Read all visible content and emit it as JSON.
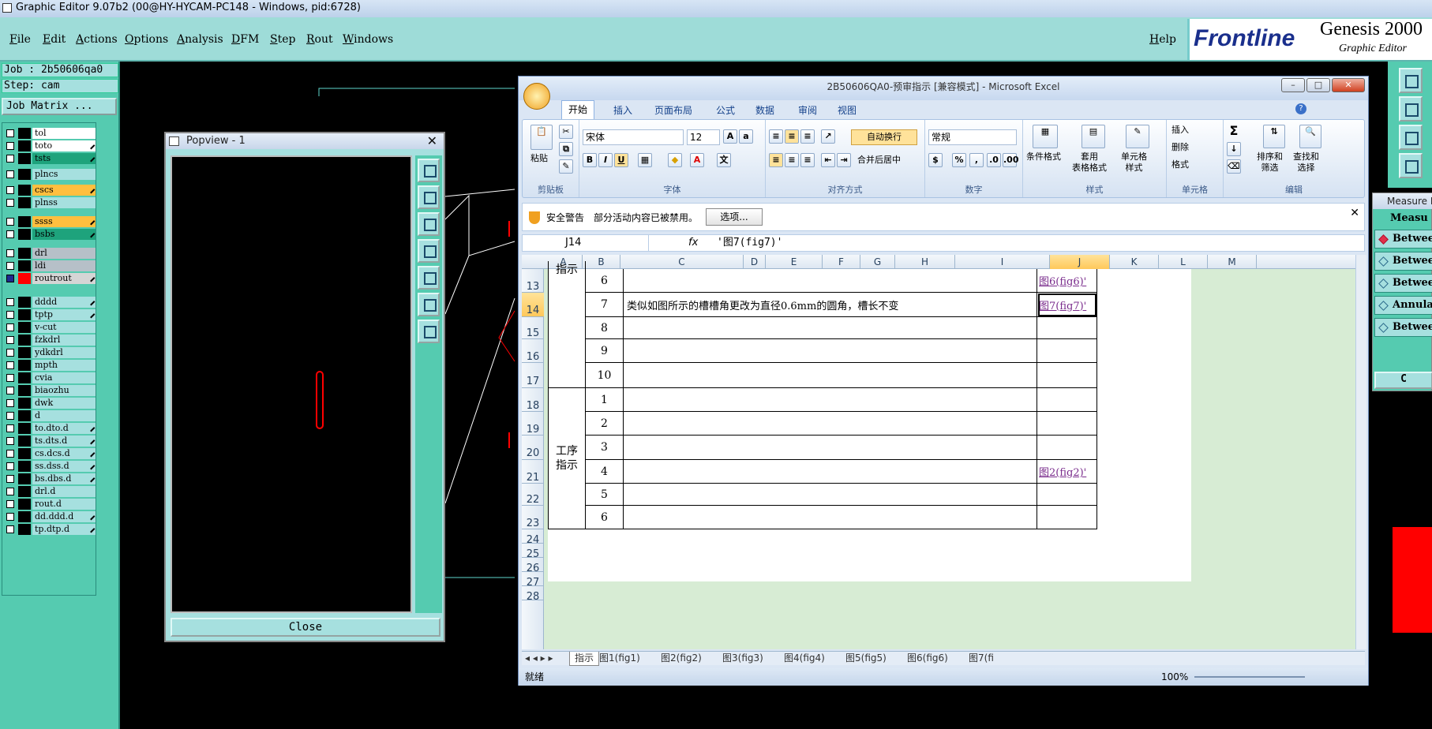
{
  "genesis": {
    "title": "Graphic Editor 9.07b2 (00@HY-HYCAM-PC148 - Windows, pid:6728)",
    "menu": [
      "File",
      "Edit",
      "Actions",
      "Options",
      "Analysis",
      "DFM",
      "Step",
      "Rout",
      "Windows"
    ],
    "help": "Help",
    "logo": {
      "brand": "Frontline",
      "product": "Genesis 2000",
      "subtitle": "Graphic Editor"
    }
  },
  "left_panel": {
    "job": "Job : 2b50606qa0",
    "step": "Step: cam",
    "job_matrix": "Job Matrix ...",
    "layers": [
      {
        "name": "tol",
        "color": "white",
        "checked": false,
        "pen": false
      },
      {
        "name": "to",
        "color": "white",
        "checked": false,
        "pen": true
      },
      {
        "name": "ts",
        "color": "green",
        "checked": false,
        "pen": true
      },
      {
        "name": "plncs",
        "color": "cyan",
        "checked": false,
        "pen": false
      },
      {
        "name": "cs",
        "color": "orange",
        "checked": false,
        "pen": true
      },
      {
        "name": "plnss",
        "color": "cyan",
        "checked": false,
        "pen": false
      },
      {
        "name": "ss",
        "color": "orange",
        "checked": false,
        "pen": true
      },
      {
        "name": "bs",
        "color": "green",
        "checked": false,
        "pen": true
      },
      {
        "name": "drl",
        "color": "gray",
        "checked": false,
        "pen": false
      },
      {
        "name": "ldi",
        "color": "gray",
        "checked": false,
        "pen": false
      },
      {
        "name": "rout",
        "color": "lgray",
        "checked": true,
        "pen": true,
        "red": true
      },
      {
        "name": "dd",
        "color": "cyan",
        "checked": false,
        "pen": true
      },
      {
        "name": "tp",
        "color": "cyan",
        "checked": false,
        "pen": true
      },
      {
        "name": "v-cut",
        "color": "cyan",
        "checked": false,
        "pen": false
      },
      {
        "name": "fzkdrl",
        "color": "cyan",
        "checked": false,
        "pen": false
      },
      {
        "name": "ydkdrl",
        "color": "cyan",
        "checked": false,
        "pen": false
      },
      {
        "name": "mpth",
        "color": "cyan",
        "checked": false,
        "pen": false
      },
      {
        "name": "cvia",
        "color": "cyan",
        "checked": false,
        "pen": false
      },
      {
        "name": "biaozhu",
        "color": "cyan",
        "checked": false,
        "pen": false
      },
      {
        "name": "dwk",
        "color": "cyan",
        "checked": false,
        "pen": false
      },
      {
        "name": "d",
        "color": "cyan",
        "checked": false,
        "pen": false
      },
      {
        "name": "to.d",
        "color": "cyan",
        "checked": false,
        "pen": true
      },
      {
        "name": "ts.d",
        "color": "cyan",
        "checked": false,
        "pen": true
      },
      {
        "name": "cs.d",
        "color": "cyan",
        "checked": false,
        "pen": true
      },
      {
        "name": "ss.d",
        "color": "cyan",
        "checked": false,
        "pen": true
      },
      {
        "name": "bs.d",
        "color": "cyan",
        "checked": false,
        "pen": true
      },
      {
        "name": "drl.d",
        "color": "cyan",
        "checked": false,
        "pen": false
      },
      {
        "name": "rout.d",
        "color": "cyan",
        "checked": false,
        "pen": false
      },
      {
        "name": "dd.d",
        "color": "cyan",
        "checked": false,
        "pen": true
      },
      {
        "name": "tp.d",
        "color": "cyan",
        "checked": false,
        "pen": true
      }
    ]
  },
  "popview": {
    "title": "Popview - 1",
    "close": "Close"
  },
  "excel": {
    "title": "2B50606QA0-预审指示 [兼容模式] - Microsoft Excel",
    "tabs": [
      "开始",
      "插入",
      "页面布局",
      "公式",
      "数据",
      "审阅",
      "视图"
    ],
    "ribbon": {
      "clipboard": "剪贴板",
      "paste": "粘贴",
      "font_group": "字体",
      "font_name": "宋体",
      "font_size": "12",
      "align_group": "对齐方式",
      "wrap": "自动换行",
      "merge": "合并后居中",
      "number_group": "数字",
      "number_format": "常规",
      "styles_group": "样式",
      "cond_format": "条件格式",
      "table_format": "套用\n表格格式",
      "cell_style": "单元格\n样式",
      "cells_group": "单元格",
      "insert": "插入",
      "delete": "删除",
      "format": "格式",
      "edit_group": "编辑",
      "sort": "排序和\n筛选",
      "find": "查找和\n选择"
    },
    "security": {
      "label": "安全警告",
      "message": "部分活动内容已被禁用。",
      "button": "选项..."
    },
    "namebox": "J14",
    "formula": "'图7(fig7)'",
    "columns": [
      "A",
      "B",
      "C",
      "D",
      "E",
      "F",
      "G",
      "H",
      "I",
      "J",
      "K",
      "L",
      "M"
    ],
    "rows": [
      "13",
      "14",
      "15",
      "16",
      "17",
      "18",
      "19",
      "20",
      "21",
      "22",
      "23",
      "24",
      "25",
      "26",
      "27",
      "28"
    ],
    "section_a_top": "指示",
    "section_b": "工序\n指示",
    "table_rows": [
      {
        "b": "6",
        "c": "",
        "j": "图6(fig6)'"
      },
      {
        "b": "7",
        "c": "类似如图所示的槽槽角更改为直径0.6mm的圆角，槽长不变",
        "j": "图7(fig7)'"
      },
      {
        "b": "8",
        "c": "",
        "j": ""
      },
      {
        "b": "9",
        "c": "",
        "j": ""
      },
      {
        "b": "10",
        "c": "",
        "j": ""
      },
      {
        "b": "1",
        "c": "",
        "j": ""
      },
      {
        "b": "2",
        "c": "",
        "j": ""
      },
      {
        "b": "3",
        "c": "",
        "j": ""
      },
      {
        "b": "4",
        "c": "",
        "j": "图2(fig2)'"
      },
      {
        "b": "5",
        "c": "",
        "j": ""
      },
      {
        "b": "6",
        "c": "",
        "j": ""
      }
    ],
    "sheets": [
      "指示",
      "图1(fig1)",
      "图2(fig2)",
      "图3(fig3)",
      "图4(fig4)",
      "图5(fig5)",
      "图6(fig6)",
      "图7(fi"
    ],
    "status": "就绪",
    "zoom": "100%"
  },
  "measure": {
    "title": "Measure B",
    "header": "Measu",
    "items": [
      "Betwee",
      "Betwee",
      "Betwee",
      "Annula",
      "Betwee"
    ],
    "button": "C"
  }
}
